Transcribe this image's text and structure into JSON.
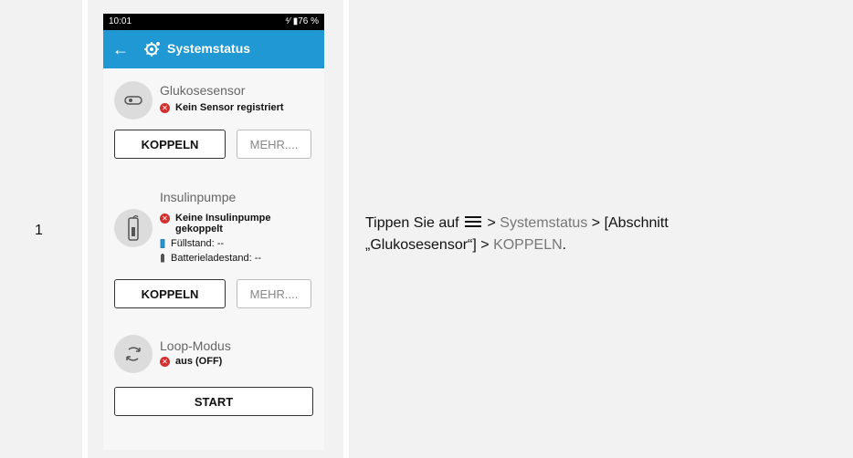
{
  "step": {
    "number": "1"
  },
  "screen": {
    "status_bar": {
      "time": "10:01",
      "right": "⁴⁄ ▮76 %"
    },
    "app_bar": {
      "title": "Systemstatus"
    },
    "glukosesensor": {
      "label": "Glukosesensor",
      "status": "Kein Sensor registriert",
      "primary_button": "KOPPELN",
      "secondary_button": "MEHR...."
    },
    "insulinpumpe": {
      "label": "Insulinpumpe",
      "status_line1": "Keine Insulinpumpe",
      "status_line2": "gekoppelt",
      "fill_level": "Füllstand: --",
      "battery_level": "Batterieladestand: --",
      "primary_button": "KOPPELN",
      "secondary_button": "MEHR...."
    },
    "loop_mode": {
      "label": "Loop-Modus",
      "status": "aus (OFF)",
      "start_button": "START"
    }
  },
  "instruction": {
    "prefix": "Tippen Sie auf",
    "separator1": " > ",
    "systemstatus": "Systemstatus",
    "separator2": " > [Abschnitt",
    "line2_start": "„Glukosesensor“] > ",
    "koppeln": "KOPPELN",
    "end": "."
  }
}
